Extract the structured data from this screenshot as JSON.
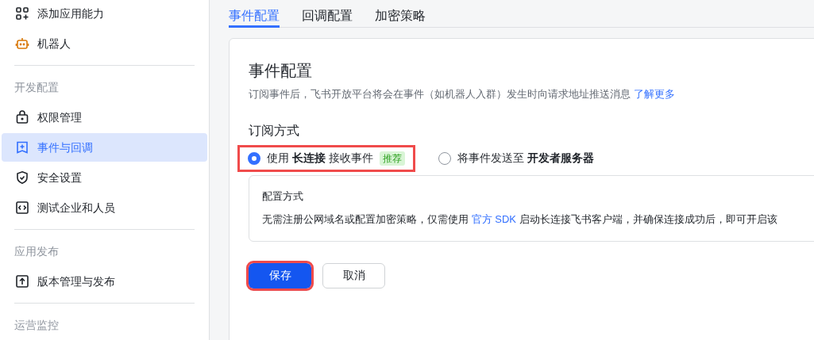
{
  "sidebar": {
    "items": [
      {
        "kind": "item",
        "label": "添加应用能力",
        "selected": false
      },
      {
        "kind": "item",
        "label": "机器人",
        "selected": false
      },
      {
        "kind": "divider"
      },
      {
        "kind": "section",
        "label": "开发配置"
      },
      {
        "kind": "item",
        "label": "权限管理",
        "selected": false
      },
      {
        "kind": "item",
        "label": "事件与回调",
        "selected": true
      },
      {
        "kind": "item",
        "label": "安全设置",
        "selected": false
      },
      {
        "kind": "item",
        "label": "测试企业和人员",
        "selected": false
      },
      {
        "kind": "divider"
      },
      {
        "kind": "section",
        "label": "应用发布"
      },
      {
        "kind": "item",
        "label": "版本管理与发布",
        "selected": false
      },
      {
        "kind": "divider"
      },
      {
        "kind": "section",
        "label": "运营监控"
      }
    ]
  },
  "tabs": [
    {
      "label": "事件配置",
      "selected": true
    },
    {
      "label": "回调配置",
      "selected": false
    },
    {
      "label": "加密策略",
      "selected": false
    }
  ],
  "card": {
    "title": "事件配置",
    "description": "订阅事件后，飞书开放平台将会在事件（如机器人入群）发生时向请求地址推送消息",
    "description_link": "了解更多",
    "subscription_label": "订阅方式",
    "options": [
      {
        "before": "使用 ",
        "bold": "长连接",
        "after": " 接收事件",
        "badge": "推荐",
        "selected": true,
        "highlighted": true
      },
      {
        "before": "将事件发送至 ",
        "bold": "开发者服务器",
        "selected": false,
        "highlighted": false
      }
    ],
    "config": {
      "title": "配置方式",
      "text_before": "无需注册公网域名或配置加密策略，仅需使用 ",
      "link": "官方 SDK",
      "text_after": " 启动长连接飞书客户端，并确保连接成功后，即可开启该"
    },
    "buttons": [
      {
        "label": "保存",
        "kind": "primary",
        "highlighted": true
      },
      {
        "label": "取消",
        "kind": "secondary",
        "highlighted": false
      }
    ]
  }
}
